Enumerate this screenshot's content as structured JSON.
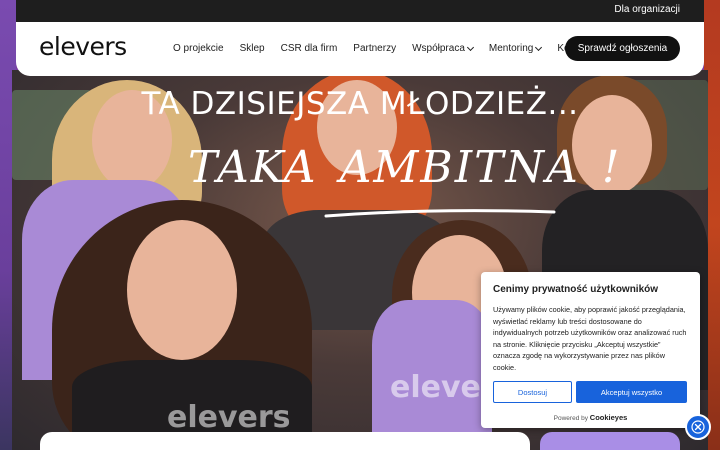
{
  "topbar": {
    "org_link": "Dla organizacji"
  },
  "nav": {
    "logo": "elevers",
    "items": [
      {
        "label": "O projekcie",
        "has_dropdown": false
      },
      {
        "label": "Sklep",
        "has_dropdown": false
      },
      {
        "label": "CSR dla firm",
        "has_dropdown": false
      },
      {
        "label": "Partnerzy",
        "has_dropdown": false
      },
      {
        "label": "Współpraca",
        "has_dropdown": true
      },
      {
        "label": "Mentoring",
        "has_dropdown": true
      },
      {
        "label": "Kontakt",
        "has_dropdown": false
      }
    ],
    "cta_label": "Sprawdź ogłoszenia"
  },
  "hero": {
    "title": "TA DZISIEJSZA MŁODZIEŻ...",
    "handwritten_1": "TAKA",
    "handwritten_2": "AMBITNA",
    "handwritten_3": "!",
    "hoodie_text": "elevers"
  },
  "cookie": {
    "title": "Cenimy prywatność użytkowników",
    "body": "Używamy plików cookie, aby poprawić jakość przeglądania, wyświetlać reklamy lub treści dostosowane do indywidualnych potrzeb użytkowników oraz analizować ruch na stronie. Kliknięcie przycisku „Akceptuj wszystkie” oznacza zgodę na wykorzystywanie przez nas plików cookie.",
    "customize_label": "Dostosuj",
    "accept_label": "Akceptuj wszystko",
    "powered_prefix": "Powered by",
    "powered_brand": "Cookieyes"
  },
  "colors": {
    "primary_blue": "#1863dc",
    "dark": "#111111",
    "purple_card": "#a98ee6"
  },
  "icons": {
    "revisit": "cookie-settings-icon",
    "dropdown": "chevron-down-icon"
  }
}
